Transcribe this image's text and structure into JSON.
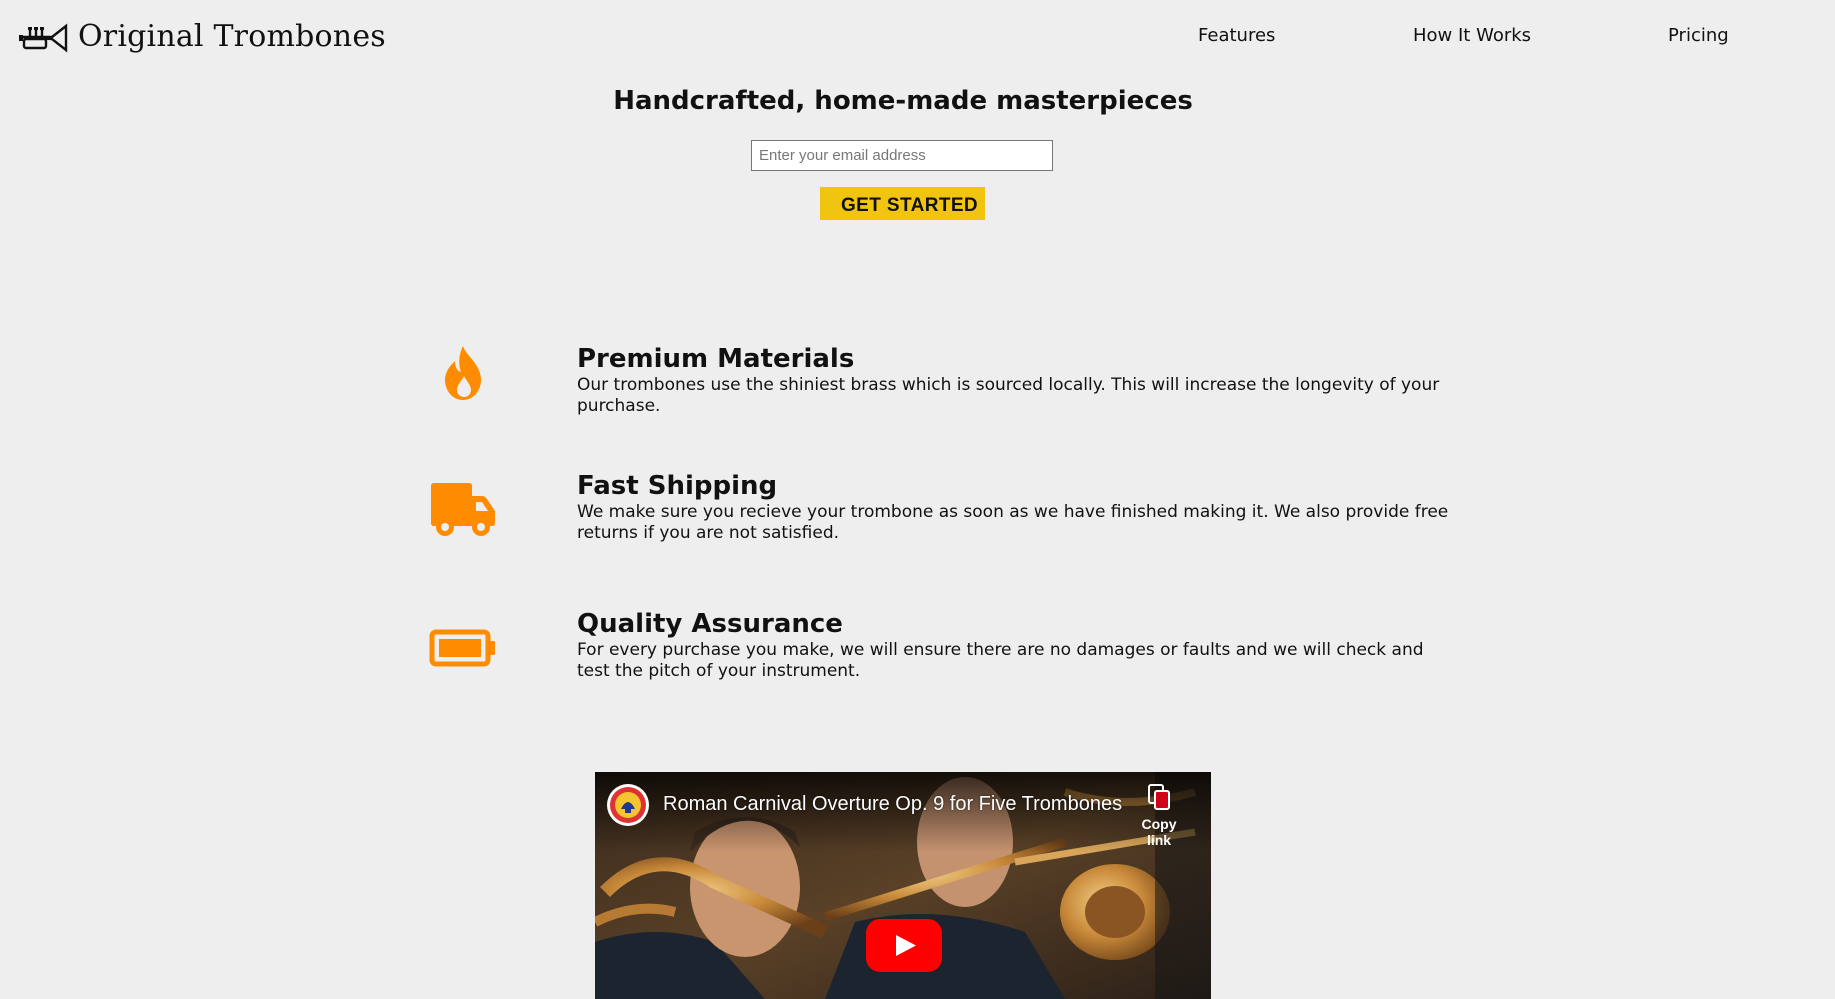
{
  "header": {
    "logo_text": "Original Trombones",
    "nav": [
      {
        "label": "Features"
      },
      {
        "label": "How It Works"
      },
      {
        "label": "Pricing"
      }
    ]
  },
  "hero": {
    "title": "Handcrafted, home-made masterpieces",
    "email_placeholder": "Enter your email address",
    "cta_label": "GET STARTED"
  },
  "features": [
    {
      "icon": "fire-icon",
      "title": "Premium Materials",
      "description": "Our trombones use the shiniest brass which is sourced locally. This will increase the longevity of your purchase."
    },
    {
      "icon": "truck-icon",
      "title": "Fast Shipping",
      "description": "We make sure you recieve your trombone as soon as we have finished making it. We also provide free returns if you are not satisfied."
    },
    {
      "icon": "battery-icon",
      "title": "Quality Assurance",
      "description": "For every purchase you make, we will ensure there are no damages or faults and we will check and test the pitch of your instrument."
    }
  ],
  "video": {
    "title": "Roman Carnival Overture Op. 9 for Five Trombones",
    "copy_link_label": "Copy link"
  },
  "colors": {
    "accent_orange": "#ff8c00",
    "cta_yellow": "#f1c40f",
    "background": "#eeeeee",
    "youtube_red": "#ff0000"
  }
}
